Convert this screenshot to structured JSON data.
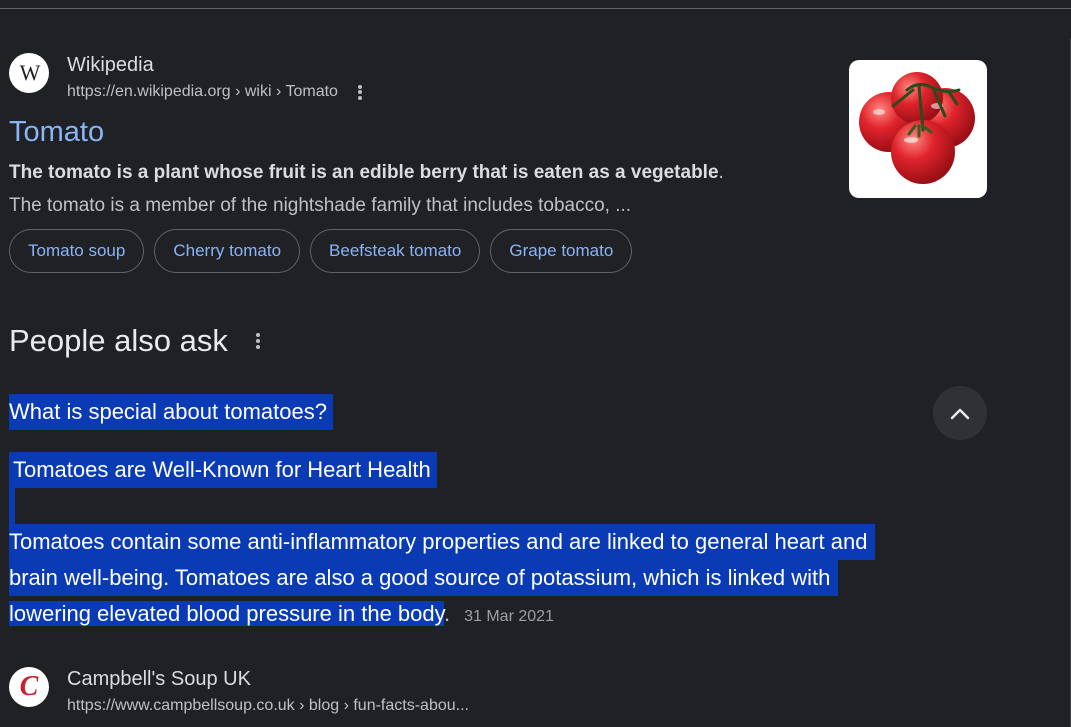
{
  "result1": {
    "site_name": "Wikipedia",
    "url": "https://en.wikipedia.org › wiki › Tomato",
    "favicon_letter": "W",
    "title": "Tomato",
    "snippet_bold": "The tomato is a plant whose fruit is an edible berry that is eaten as a vegetable",
    "snippet_bold_end": ".",
    "snippet_2": "The tomato is a member of the nightshade family that includes tobacco, ...",
    "chips": [
      "Tomato soup",
      "Cherry tomato",
      "Beefsteak tomato",
      "Grape tomato"
    ]
  },
  "people_also_ask": {
    "title": "People also ask",
    "question": "What is special about tomatoes?",
    "answer_heading": "Tomatoes are Well-Known for Heart Health",
    "answer_lines": [
      "Tomatoes contain some anti-inflammatory properties and are linked to general heart and",
      "brain well-being. Tomatoes are also a good source of potassium, which is linked with",
      "lowering elevated blood pressure in the body"
    ],
    "answer_end": ".",
    "answer_date": "31 Mar 2021"
  },
  "result2": {
    "site_name": "Campbell's Soup UK",
    "url": "https://www.campbellsoup.co.uk › blog › fun-facts-abou...",
    "favicon_letter": "C"
  },
  "colors": {
    "background": "#202124",
    "link": "#8ab4f8",
    "selection": "#0a3bb5",
    "tomato_red": "#e0242c"
  },
  "icons": [
    "wikipedia-favicon",
    "more-vert-icon",
    "tomato-thumbnail",
    "chevron-up-icon",
    "campbells-favicon"
  ]
}
